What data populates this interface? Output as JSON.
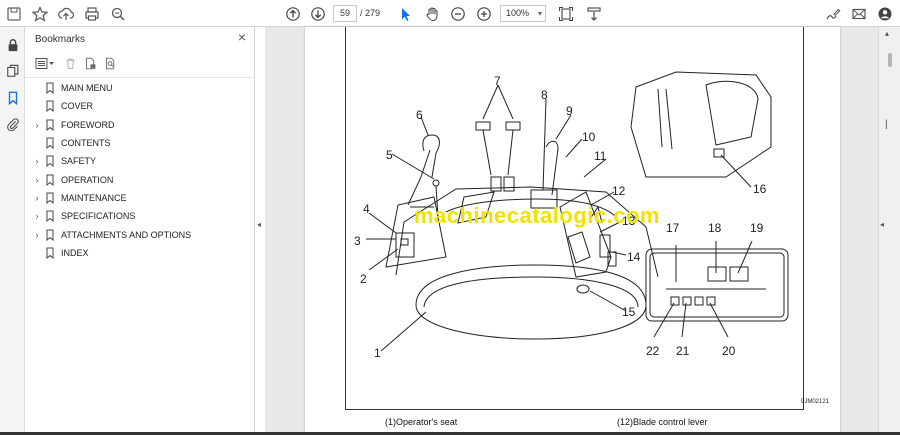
{
  "toolbar": {
    "page_current": "59",
    "page_total": "/ 279",
    "zoom": "100%",
    "zoom_arrow": "▾"
  },
  "bookmarks": {
    "title": "Bookmarks",
    "close": "×",
    "items": [
      {
        "label": "MAIN MENU",
        "expandable": false
      },
      {
        "label": "COVER",
        "expandable": false
      },
      {
        "label": "FOREWORD",
        "expandable": true
      },
      {
        "label": "CONTENTS",
        "expandable": false
      },
      {
        "label": "SAFETY",
        "expandable": true
      },
      {
        "label": "OPERATION",
        "expandable": true
      },
      {
        "label": "MAINTENANCE",
        "expandable": true
      },
      {
        "label": "SPECIFICATIONS",
        "expandable": true
      },
      {
        "label": "ATTACHMENTS AND OPTIONS",
        "expandable": true
      },
      {
        "label": "INDEX",
        "expandable": false
      }
    ],
    "expand_glyph": "›"
  },
  "document": {
    "watermark": "machinecatalogic.com",
    "figure_code": "9JM02121",
    "caption_left": "(1)Operator's seat",
    "caption_right": "(12)Blade control lever",
    "callouts": [
      "1",
      "2",
      "3",
      "4",
      "5",
      "6",
      "7",
      "8",
      "9",
      "10",
      "11",
      "12",
      "13",
      "14",
      "15",
      "16",
      "17",
      "18",
      "19",
      "20",
      "21",
      "22"
    ]
  },
  "colors": {
    "accent_blue": "#1473e6",
    "watermark_yellow": "#f2e200"
  },
  "icons": [
    "save-icon",
    "bookmark-star-icon",
    "upload-icon",
    "print-icon",
    "search-zoom-icon",
    "page-up-icon",
    "page-down-icon",
    "select-arrow-icon",
    "hand-icon",
    "zoom-out-icon",
    "zoom-in-icon",
    "fit-page-icon",
    "scroll-mode-icon",
    "sign-icon",
    "mail-icon",
    "account-icon",
    "lock-icon",
    "pages-icon",
    "bookmark-panel-icon",
    "attachment-icon"
  ]
}
